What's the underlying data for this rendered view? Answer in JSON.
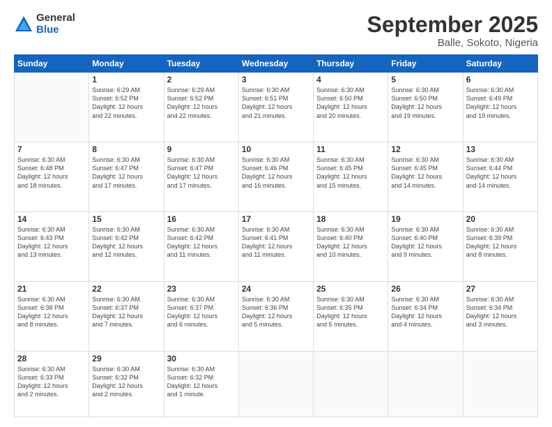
{
  "logo": {
    "general": "General",
    "blue": "Blue"
  },
  "title": "September 2025",
  "subtitle": "Balle, Sokoto, Nigeria",
  "days_of_week": [
    "Sunday",
    "Monday",
    "Tuesday",
    "Wednesday",
    "Thursday",
    "Friday",
    "Saturday"
  ],
  "weeks": [
    [
      {
        "num": "",
        "info": ""
      },
      {
        "num": "1",
        "info": "Sunrise: 6:29 AM\nSunset: 6:52 PM\nDaylight: 12 hours\nand 22 minutes."
      },
      {
        "num": "2",
        "info": "Sunrise: 6:29 AM\nSunset: 6:52 PM\nDaylight: 12 hours\nand 22 minutes."
      },
      {
        "num": "3",
        "info": "Sunrise: 6:30 AM\nSunset: 6:51 PM\nDaylight: 12 hours\nand 21 minutes."
      },
      {
        "num": "4",
        "info": "Sunrise: 6:30 AM\nSunset: 6:50 PM\nDaylight: 12 hours\nand 20 minutes."
      },
      {
        "num": "5",
        "info": "Sunrise: 6:30 AM\nSunset: 6:50 PM\nDaylight: 12 hours\nand 19 minutes."
      },
      {
        "num": "6",
        "info": "Sunrise: 6:30 AM\nSunset: 6:49 PM\nDaylight: 12 hours\nand 19 minutes."
      }
    ],
    [
      {
        "num": "7",
        "info": "Sunrise: 6:30 AM\nSunset: 6:48 PM\nDaylight: 12 hours\nand 18 minutes."
      },
      {
        "num": "8",
        "info": "Sunrise: 6:30 AM\nSunset: 6:47 PM\nDaylight: 12 hours\nand 17 minutes."
      },
      {
        "num": "9",
        "info": "Sunrise: 6:30 AM\nSunset: 6:47 PM\nDaylight: 12 hours\nand 17 minutes."
      },
      {
        "num": "10",
        "info": "Sunrise: 6:30 AM\nSunset: 6:46 PM\nDaylight: 12 hours\nand 16 minutes."
      },
      {
        "num": "11",
        "info": "Sunrise: 6:30 AM\nSunset: 6:45 PM\nDaylight: 12 hours\nand 15 minutes."
      },
      {
        "num": "12",
        "info": "Sunrise: 6:30 AM\nSunset: 6:45 PM\nDaylight: 12 hours\nand 14 minutes."
      },
      {
        "num": "13",
        "info": "Sunrise: 6:30 AM\nSunset: 6:44 PM\nDaylight: 12 hours\nand 14 minutes."
      }
    ],
    [
      {
        "num": "14",
        "info": "Sunrise: 6:30 AM\nSunset: 6:43 PM\nDaylight: 12 hours\nand 13 minutes."
      },
      {
        "num": "15",
        "info": "Sunrise: 6:30 AM\nSunset: 6:42 PM\nDaylight: 12 hours\nand 12 minutes."
      },
      {
        "num": "16",
        "info": "Sunrise: 6:30 AM\nSunset: 6:42 PM\nDaylight: 12 hours\nand 11 minutes."
      },
      {
        "num": "17",
        "info": "Sunrise: 6:30 AM\nSunset: 6:41 PM\nDaylight: 12 hours\nand 11 minutes."
      },
      {
        "num": "18",
        "info": "Sunrise: 6:30 AM\nSunset: 6:40 PM\nDaylight: 12 hours\nand 10 minutes."
      },
      {
        "num": "19",
        "info": "Sunrise: 6:30 AM\nSunset: 6:40 PM\nDaylight: 12 hours\nand 9 minutes."
      },
      {
        "num": "20",
        "info": "Sunrise: 6:30 AM\nSunset: 6:39 PM\nDaylight: 12 hours\nand 8 minutes."
      }
    ],
    [
      {
        "num": "21",
        "info": "Sunrise: 6:30 AM\nSunset: 6:38 PM\nDaylight: 12 hours\nand 8 minutes."
      },
      {
        "num": "22",
        "info": "Sunrise: 6:30 AM\nSunset: 6:37 PM\nDaylight: 12 hours\nand 7 minutes."
      },
      {
        "num": "23",
        "info": "Sunrise: 6:30 AM\nSunset: 6:37 PM\nDaylight: 12 hours\nand 6 minutes."
      },
      {
        "num": "24",
        "info": "Sunrise: 6:30 AM\nSunset: 6:36 PM\nDaylight: 12 hours\nand 5 minutes."
      },
      {
        "num": "25",
        "info": "Sunrise: 6:30 AM\nSunset: 6:35 PM\nDaylight: 12 hours\nand 5 minutes."
      },
      {
        "num": "26",
        "info": "Sunrise: 6:30 AM\nSunset: 6:34 PM\nDaylight: 12 hours\nand 4 minutes."
      },
      {
        "num": "27",
        "info": "Sunrise: 6:30 AM\nSunset: 6:34 PM\nDaylight: 12 hours\nand 3 minutes."
      }
    ],
    [
      {
        "num": "28",
        "info": "Sunrise: 6:30 AM\nSunset: 6:33 PM\nDaylight: 12 hours\nand 2 minutes."
      },
      {
        "num": "29",
        "info": "Sunrise: 6:30 AM\nSunset: 6:32 PM\nDaylight: 12 hours\nand 2 minutes."
      },
      {
        "num": "30",
        "info": "Sunrise: 6:30 AM\nSunset: 6:32 PM\nDaylight: 12 hours\nand 1 minute."
      },
      {
        "num": "",
        "info": ""
      },
      {
        "num": "",
        "info": ""
      },
      {
        "num": "",
        "info": ""
      },
      {
        "num": "",
        "info": ""
      }
    ]
  ]
}
